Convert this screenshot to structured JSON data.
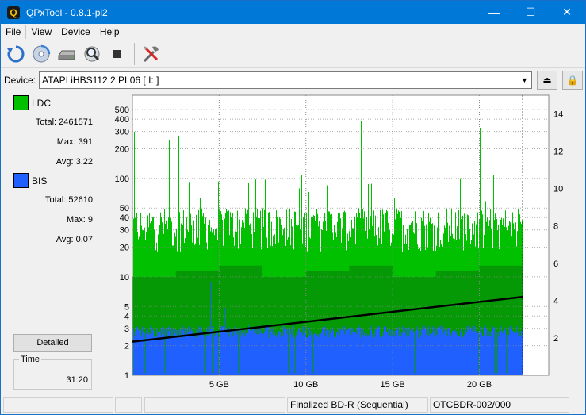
{
  "window": {
    "title": "QPxTool - 0.8.1-pl2",
    "app_icon_letter": "Q",
    "minimize": "—",
    "maximize": "☐",
    "close": "✕"
  },
  "menu": {
    "items": [
      "File",
      "View",
      "Device",
      "Help"
    ]
  },
  "toolbar": {
    "icons": [
      "refresh-icon",
      "disc-scan-icon",
      "drive-icon",
      "zoom-icon",
      "stop-icon",
      "settings-tools-icon"
    ]
  },
  "device": {
    "label": "Device:",
    "value": "ATAPI   iHBS112   2    PL06 [ I: ]",
    "eject_glyph": "⏏",
    "lock_glyph": "🔒"
  },
  "legend": {
    "ldc": {
      "name": "LDC",
      "color": "#00c000",
      "total_label": "Total:",
      "total": "2461571",
      "max_label": "Max:",
      "max": "391",
      "avg_label": "Avg:",
      "avg": "3.22"
    },
    "bis": {
      "name": "BIS",
      "color": "#2060ff",
      "total_label": "Total:",
      "total": "52610",
      "max_label": "Max:",
      "max": "9",
      "avg_label": "Avg:",
      "avg": "0.07"
    }
  },
  "detailed_label": "Detailed",
  "time": {
    "label": "Time",
    "value": "31:20"
  },
  "status": {
    "cells": [
      "",
      "",
      "Finalized BD-R (Sequential)",
      "OTCBDR-002/000",
      ""
    ]
  },
  "chart_data": {
    "type": "bar",
    "x_ticks": [
      "5 GB",
      "10 GB",
      "15 GB",
      "20 GB"
    ],
    "x_tick_values": [
      5,
      10,
      15,
      20
    ],
    "xlim": [
      0,
      24
    ],
    "data_end": 22.5,
    "y_left_ticks": [
      1,
      2,
      3,
      4,
      5,
      10,
      20,
      30,
      40,
      50,
      100,
      200,
      300,
      400,
      500
    ],
    "y_left_scale": "log",
    "ylim_left": [
      1,
      700
    ],
    "y_right_ticks": [
      2,
      4,
      6,
      8,
      10,
      12,
      14
    ],
    "ylim_right": [
      0,
      15
    ],
    "grid": true,
    "series": [
      {
        "name": "LDC",
        "color": "#00c000",
        "typical_max": 50,
        "peak_max": 391
      },
      {
        "name": "BIS",
        "color": "#2060ff",
        "typical_max": 3,
        "peak_max": 9
      },
      {
        "color": "#000000",
        "type": "line",
        "axis": "right",
        "x": [
          0,
          22.5
        ],
        "y": [
          1.8,
          4.2
        ]
      }
    ]
  }
}
